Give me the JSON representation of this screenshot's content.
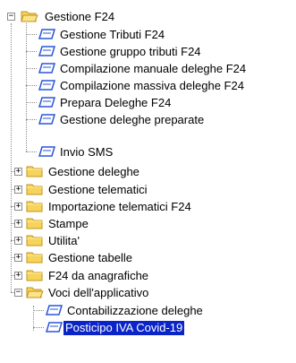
{
  "tree": {
    "root": {
      "label": "Gestione F24",
      "icon": "folder-open-icon",
      "expander": "−"
    },
    "leaf_items": [
      {
        "label": "Gestione Tributi F24",
        "icon": "form-icon"
      },
      {
        "label": "Gestione gruppo tributi F24",
        "icon": "form-icon"
      },
      {
        "label": "Compilazione manuale deleghe F24",
        "icon": "form-icon"
      },
      {
        "label": "Compilazione massiva deleghe F24",
        "icon": "form-icon"
      },
      {
        "label": "Prepara Deleghe F24",
        "icon": "form-icon"
      },
      {
        "label": "Gestione deleghe preparate",
        "icon": "form-icon"
      },
      {
        "label": "Invio SMS",
        "icon": "form-icon"
      }
    ],
    "folders": [
      {
        "label": "Gestione deleghe",
        "icon": "folder-icon",
        "expander": "+"
      },
      {
        "label": "Gestione telematici",
        "icon": "folder-icon",
        "expander": "+"
      },
      {
        "label": "Importazione telematici F24",
        "icon": "folder-icon",
        "expander": "+"
      },
      {
        "label": "Stampe",
        "icon": "folder-icon",
        "expander": "+"
      },
      {
        "label": "Utilita'",
        "icon": "folder-icon",
        "expander": "+"
      },
      {
        "label": "Gestione tabelle",
        "icon": "folder-icon",
        "expander": "+"
      },
      {
        "label": "F24 da anagrafiche",
        "icon": "folder-icon",
        "expander": "+"
      }
    ],
    "voci": {
      "label": "Voci dell'applicativo",
      "icon": "folder-open-icon",
      "expander": "−",
      "children": [
        {
          "label": "Contabilizzazione deleghe",
          "icon": "form-icon"
        },
        {
          "label": "Posticipo IVA Covid-19",
          "icon": "form-icon",
          "selected": true
        }
      ]
    }
  },
  "colors": {
    "folder_fill": "#f6d35a",
    "folder_stroke": "#c2941c",
    "selection": "#0a24c8",
    "form_icon": "#2a55d8"
  }
}
